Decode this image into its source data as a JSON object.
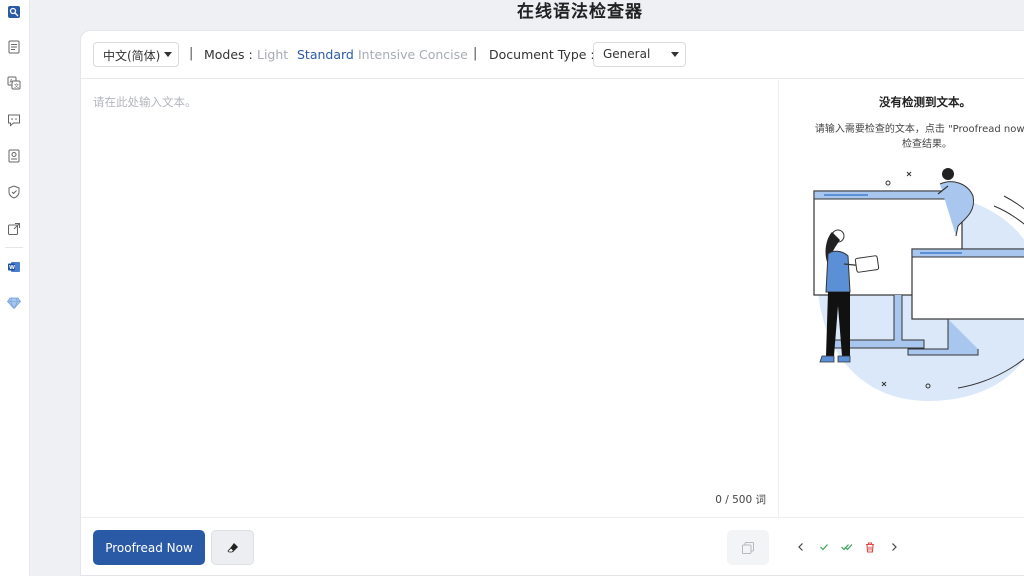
{
  "app": {
    "title": "在线语法检查器"
  },
  "sidebar": {
    "icons": [
      "grammar-checker-icon",
      "document-icon",
      "translate-icon",
      "chat-icon",
      "id-card-icon",
      "shield-icon",
      "external-link-icon",
      "word-icon",
      "diamond-icon"
    ]
  },
  "toolbar": {
    "language": "中文(简体)",
    "modes_label": "Modes :",
    "modes": [
      {
        "label": "Light",
        "active": false
      },
      {
        "label": "Standard",
        "active": true
      },
      {
        "label": "Intensive",
        "active": false
      },
      {
        "label": "Concise",
        "active": false
      }
    ],
    "doc_type_label": "Document Type :",
    "doc_type_value": "General",
    "separator": "|"
  },
  "editor": {
    "placeholder": "请在此处输入文本。",
    "value": "",
    "word_count": "0 / 500 词"
  },
  "results": {
    "title": "没有检测到文本。",
    "description_line1": "请输入需要检查的文本，点击 \"Proofread now\"，",
    "description_line2": "检查结果。"
  },
  "footer": {
    "proofread_label": "Proofread Now"
  },
  "colors": {
    "accent": "#2a5aa6",
    "illustration_blue": "#a9c7ee",
    "delete_red": "#e04848",
    "check_green": "#3aa55d"
  }
}
